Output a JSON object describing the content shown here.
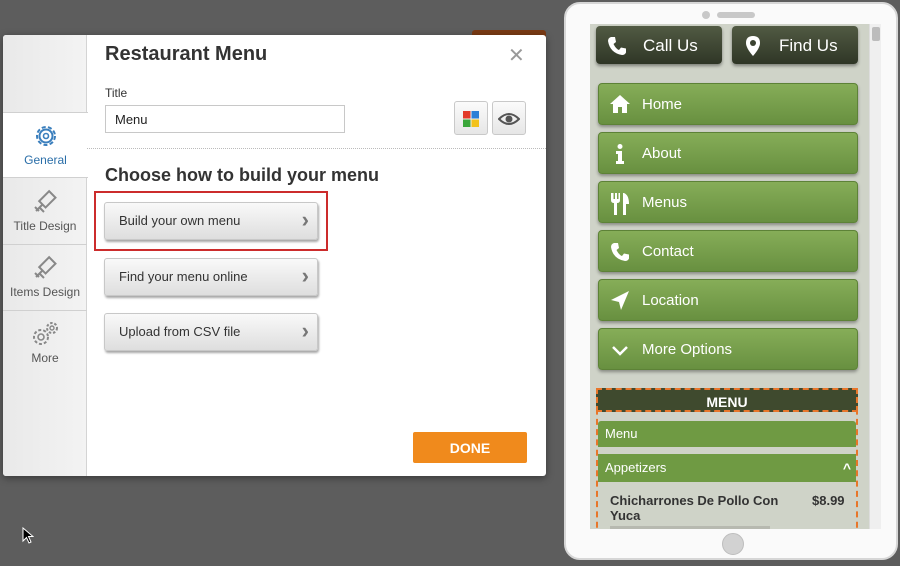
{
  "editor": {
    "title": "Restaurant Menu",
    "close_glyph": "✕",
    "sidebar_tabs": [
      {
        "label": "General",
        "icon": "gear-icon"
      },
      {
        "label": "Title Design",
        "icon": "brush-icon"
      },
      {
        "label": "Items Design",
        "icon": "brush-icon"
      },
      {
        "label": "More",
        "icon": "gears-icon"
      }
    ],
    "title_field_label": "Title",
    "title_value": "Menu",
    "section_heading": "Choose how to build your menu",
    "options": [
      {
        "label": "Build your own menu"
      },
      {
        "label": "Find your menu online"
      },
      {
        "label": "Upload from CSV file"
      }
    ],
    "chevron": "›",
    "done_label": "DONE"
  },
  "preview": {
    "cta_buttons": [
      {
        "label": "Call Us",
        "icon": "phone-icon"
      },
      {
        "label": "Find Us",
        "icon": "map-pin-icon"
      }
    ],
    "nav": [
      {
        "label": "Home",
        "icon": "home-icon"
      },
      {
        "label": "About",
        "icon": "info-icon"
      },
      {
        "label": "Menus",
        "icon": "utensils-icon"
      },
      {
        "label": "Contact",
        "icon": "phone-icon"
      },
      {
        "label": "Location",
        "icon": "location-arrow-icon"
      },
      {
        "label": "More Options",
        "icon": "chevron-down-icon"
      }
    ],
    "menu_header": "MENU",
    "menu_tab": "Menu",
    "category": "Appetizers",
    "category_toggle": "^",
    "item": {
      "name": "Chicharrones De Pollo Con Yuca",
      "price": "$8.99"
    }
  },
  "colors": {
    "accent_orange": "#f08a1c",
    "nav_green": "#6f9a43",
    "dark_olive": "#3f4a2e",
    "highlight_red": "#cc2c2c",
    "link_blue": "#2a6ea8"
  }
}
